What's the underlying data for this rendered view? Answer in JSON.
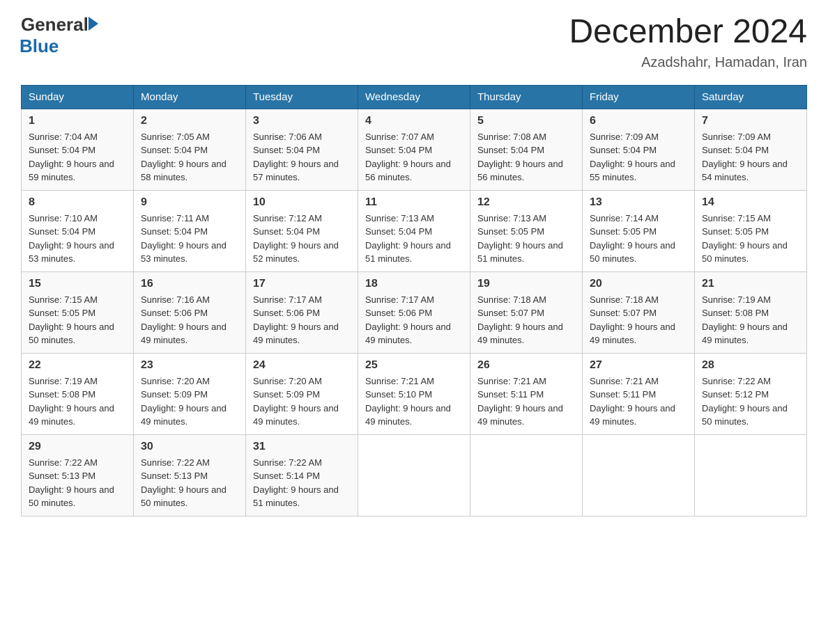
{
  "header": {
    "logo_general": "General",
    "logo_blue": "Blue",
    "month_title": "December 2024",
    "location": "Azadshahr, Hamadan, Iran"
  },
  "weekdays": [
    "Sunday",
    "Monday",
    "Tuesday",
    "Wednesday",
    "Thursday",
    "Friday",
    "Saturday"
  ],
  "weeks": [
    [
      {
        "day": "1",
        "sunrise": "7:04 AM",
        "sunset": "5:04 PM",
        "daylight": "9 hours and 59 minutes."
      },
      {
        "day": "2",
        "sunrise": "7:05 AM",
        "sunset": "5:04 PM",
        "daylight": "9 hours and 58 minutes."
      },
      {
        "day": "3",
        "sunrise": "7:06 AM",
        "sunset": "5:04 PM",
        "daylight": "9 hours and 57 minutes."
      },
      {
        "day": "4",
        "sunrise": "7:07 AM",
        "sunset": "5:04 PM",
        "daylight": "9 hours and 56 minutes."
      },
      {
        "day": "5",
        "sunrise": "7:08 AM",
        "sunset": "5:04 PM",
        "daylight": "9 hours and 56 minutes."
      },
      {
        "day": "6",
        "sunrise": "7:09 AM",
        "sunset": "5:04 PM",
        "daylight": "9 hours and 55 minutes."
      },
      {
        "day": "7",
        "sunrise": "7:09 AM",
        "sunset": "5:04 PM",
        "daylight": "9 hours and 54 minutes."
      }
    ],
    [
      {
        "day": "8",
        "sunrise": "7:10 AM",
        "sunset": "5:04 PM",
        "daylight": "9 hours and 53 minutes."
      },
      {
        "day": "9",
        "sunrise": "7:11 AM",
        "sunset": "5:04 PM",
        "daylight": "9 hours and 53 minutes."
      },
      {
        "day": "10",
        "sunrise": "7:12 AM",
        "sunset": "5:04 PM",
        "daylight": "9 hours and 52 minutes."
      },
      {
        "day": "11",
        "sunrise": "7:13 AM",
        "sunset": "5:04 PM",
        "daylight": "9 hours and 51 minutes."
      },
      {
        "day": "12",
        "sunrise": "7:13 AM",
        "sunset": "5:05 PM",
        "daylight": "9 hours and 51 minutes."
      },
      {
        "day": "13",
        "sunrise": "7:14 AM",
        "sunset": "5:05 PM",
        "daylight": "9 hours and 50 minutes."
      },
      {
        "day": "14",
        "sunrise": "7:15 AM",
        "sunset": "5:05 PM",
        "daylight": "9 hours and 50 minutes."
      }
    ],
    [
      {
        "day": "15",
        "sunrise": "7:15 AM",
        "sunset": "5:05 PM",
        "daylight": "9 hours and 50 minutes."
      },
      {
        "day": "16",
        "sunrise": "7:16 AM",
        "sunset": "5:06 PM",
        "daylight": "9 hours and 49 minutes."
      },
      {
        "day": "17",
        "sunrise": "7:17 AM",
        "sunset": "5:06 PM",
        "daylight": "9 hours and 49 minutes."
      },
      {
        "day": "18",
        "sunrise": "7:17 AM",
        "sunset": "5:06 PM",
        "daylight": "9 hours and 49 minutes."
      },
      {
        "day": "19",
        "sunrise": "7:18 AM",
        "sunset": "5:07 PM",
        "daylight": "9 hours and 49 minutes."
      },
      {
        "day": "20",
        "sunrise": "7:18 AM",
        "sunset": "5:07 PM",
        "daylight": "9 hours and 49 minutes."
      },
      {
        "day": "21",
        "sunrise": "7:19 AM",
        "sunset": "5:08 PM",
        "daylight": "9 hours and 49 minutes."
      }
    ],
    [
      {
        "day": "22",
        "sunrise": "7:19 AM",
        "sunset": "5:08 PM",
        "daylight": "9 hours and 49 minutes."
      },
      {
        "day": "23",
        "sunrise": "7:20 AM",
        "sunset": "5:09 PM",
        "daylight": "9 hours and 49 minutes."
      },
      {
        "day": "24",
        "sunrise": "7:20 AM",
        "sunset": "5:09 PM",
        "daylight": "9 hours and 49 minutes."
      },
      {
        "day": "25",
        "sunrise": "7:21 AM",
        "sunset": "5:10 PM",
        "daylight": "9 hours and 49 minutes."
      },
      {
        "day": "26",
        "sunrise": "7:21 AM",
        "sunset": "5:11 PM",
        "daylight": "9 hours and 49 minutes."
      },
      {
        "day": "27",
        "sunrise": "7:21 AM",
        "sunset": "5:11 PM",
        "daylight": "9 hours and 49 minutes."
      },
      {
        "day": "28",
        "sunrise": "7:22 AM",
        "sunset": "5:12 PM",
        "daylight": "9 hours and 50 minutes."
      }
    ],
    [
      {
        "day": "29",
        "sunrise": "7:22 AM",
        "sunset": "5:13 PM",
        "daylight": "9 hours and 50 minutes."
      },
      {
        "day": "30",
        "sunrise": "7:22 AM",
        "sunset": "5:13 PM",
        "daylight": "9 hours and 50 minutes."
      },
      {
        "day": "31",
        "sunrise": "7:22 AM",
        "sunset": "5:14 PM",
        "daylight": "9 hours and 51 minutes."
      },
      null,
      null,
      null,
      null
    ]
  ]
}
